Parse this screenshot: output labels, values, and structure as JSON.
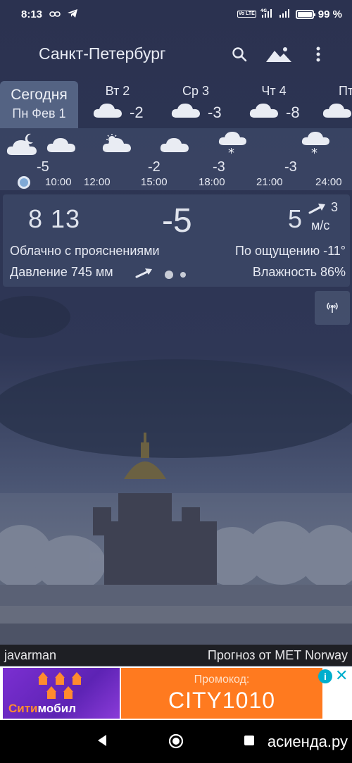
{
  "status_bar": {
    "time": "8:13",
    "battery_percent": "99 %",
    "battery_level": 0.99,
    "network": "4G",
    "volte": "Vo LTE",
    "icons": [
      "link-icon",
      "telegram-icon",
      "signal-icon",
      "signal-icon",
      "battery-icon"
    ]
  },
  "header": {
    "city": "Санкт-Петербург",
    "icons": [
      "search-icon",
      "landscape-icon",
      "more-vert-icon"
    ]
  },
  "days": {
    "today": {
      "label": "Сегодня",
      "date": "Пн Фев 1"
    },
    "items": [
      {
        "name": "Вт 2",
        "temp": "-2",
        "icon": "cloud-icon"
      },
      {
        "name": "Ср 3",
        "temp": "-3",
        "icon": "cloud-icon"
      },
      {
        "name": "Чт 4",
        "temp": "-8",
        "icon": "cloud-icon"
      },
      {
        "name": "Пт",
        "temp": "",
        "icon": "cloud-icon"
      }
    ]
  },
  "hourly": {
    "temps": [
      "-5",
      "-2",
      "-3",
      "-3"
    ],
    "times": [
      "10:00",
      "12:00",
      "15:00",
      "18:00",
      "21:00",
      "24:00"
    ],
    "icons": [
      "cloud-moon-icon",
      "cloud-icon",
      "cloud-sun-icon",
      "cloud-icon",
      "snow-cloud-icon",
      "snow-cloud-icon"
    ]
  },
  "current": {
    "time": "8 13",
    "temperature": "-5",
    "wind_speed": "5",
    "wind_gust": "3",
    "wind_unit": "м/с",
    "condition": "Облачно с прояснениями",
    "feels_like": "По ощущению -11°",
    "pressure": "Давление 745 мм",
    "humidity": "Влажность 86%"
  },
  "radar": {
    "icon": "radar-icon"
  },
  "credits": {
    "author": "javarman",
    "source": "Прогноз от MET Norway"
  },
  "ad": {
    "brand_part1": "Сити",
    "brand_part2": "мобил",
    "promo_label": "Промокод:",
    "promo_code": "CITY1010",
    "info": "i",
    "close": "✕"
  },
  "nav": {
    "icons": [
      "back-icon",
      "home-icon",
      "recents-icon"
    ],
    "watermark": "асиенда.ру"
  }
}
